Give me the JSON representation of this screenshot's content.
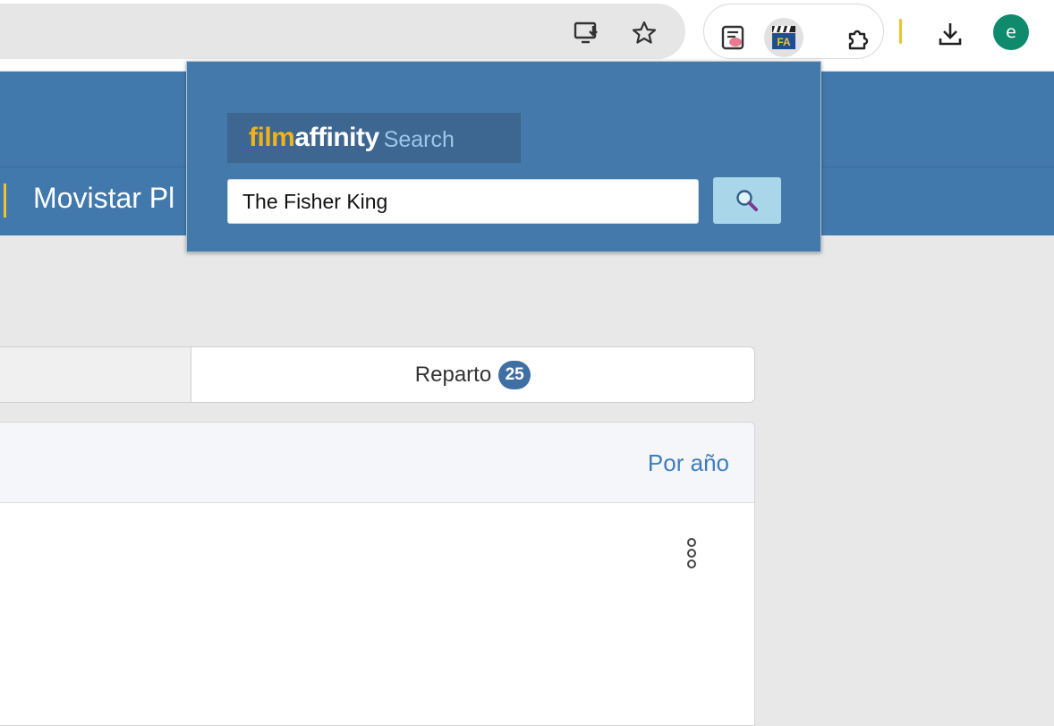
{
  "browser": {
    "icons": {
      "install": "install-app-icon",
      "bookmark": "bookmark-star-icon",
      "reader": "reading-mode-extension-icon",
      "filmaffinity": "filmaffinity-extension-icon",
      "extensions": "extensions-puzzle-icon",
      "download": "download-icon"
    },
    "profile_initial": "e",
    "fa_icon_text": "FA"
  },
  "page": {
    "nav_link": "Movistar Pl",
    "tabs": [
      {
        "label": "Reparto",
        "count": "25"
      }
    ],
    "sort_label": "Por año"
  },
  "popup": {
    "logo_film": "film",
    "logo_affinity": "affinity",
    "logo_search": "Search",
    "search_value": "The Fisher King",
    "search_button_icon": "magnifier-icon"
  },
  "colors": {
    "header": "#4279ad",
    "popup": "#4479ab",
    "accent_yellow": "#f2c12e",
    "badge": "#3f6fa3",
    "link": "#3f7cbf",
    "avatar": "#0f8a6c"
  }
}
